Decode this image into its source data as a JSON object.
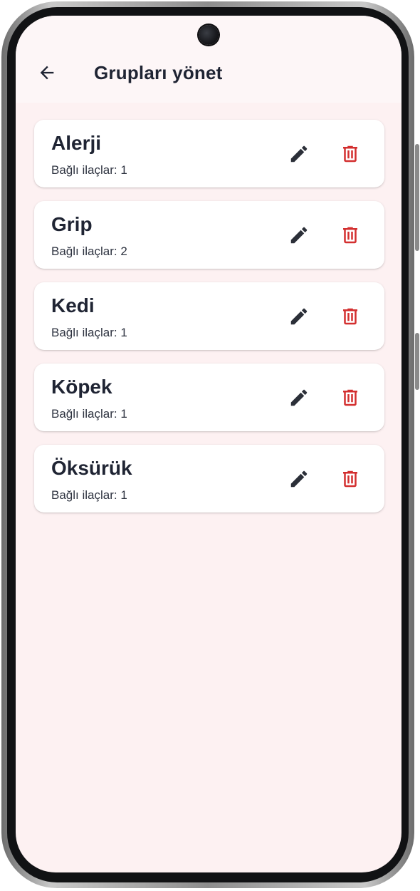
{
  "header": {
    "title": "Grupları yönet",
    "back_icon": "arrow-left-icon"
  },
  "groups": [
    {
      "name": "Alerji",
      "linked_text": "Bağlı ilaçlar: 1"
    },
    {
      "name": "Grip",
      "linked_text": "Bağlı ilaçlar: 2"
    },
    {
      "name": "Kedi",
      "linked_text": "Bağlı ilaçlar: 1"
    },
    {
      "name": "Köpek",
      "linked_text": "Bağlı ilaçlar: 1"
    },
    {
      "name": "Öksürük",
      "linked_text": "Bağlı ilaçlar: 1"
    }
  ],
  "icons": {
    "edit": "pencil-icon",
    "delete": "trash-icon"
  },
  "colors": {
    "background": "#fdf1f2",
    "text_primary": "#1f2433",
    "delete_red": "#d32f2f",
    "icon_dark": "#2b2f38"
  }
}
